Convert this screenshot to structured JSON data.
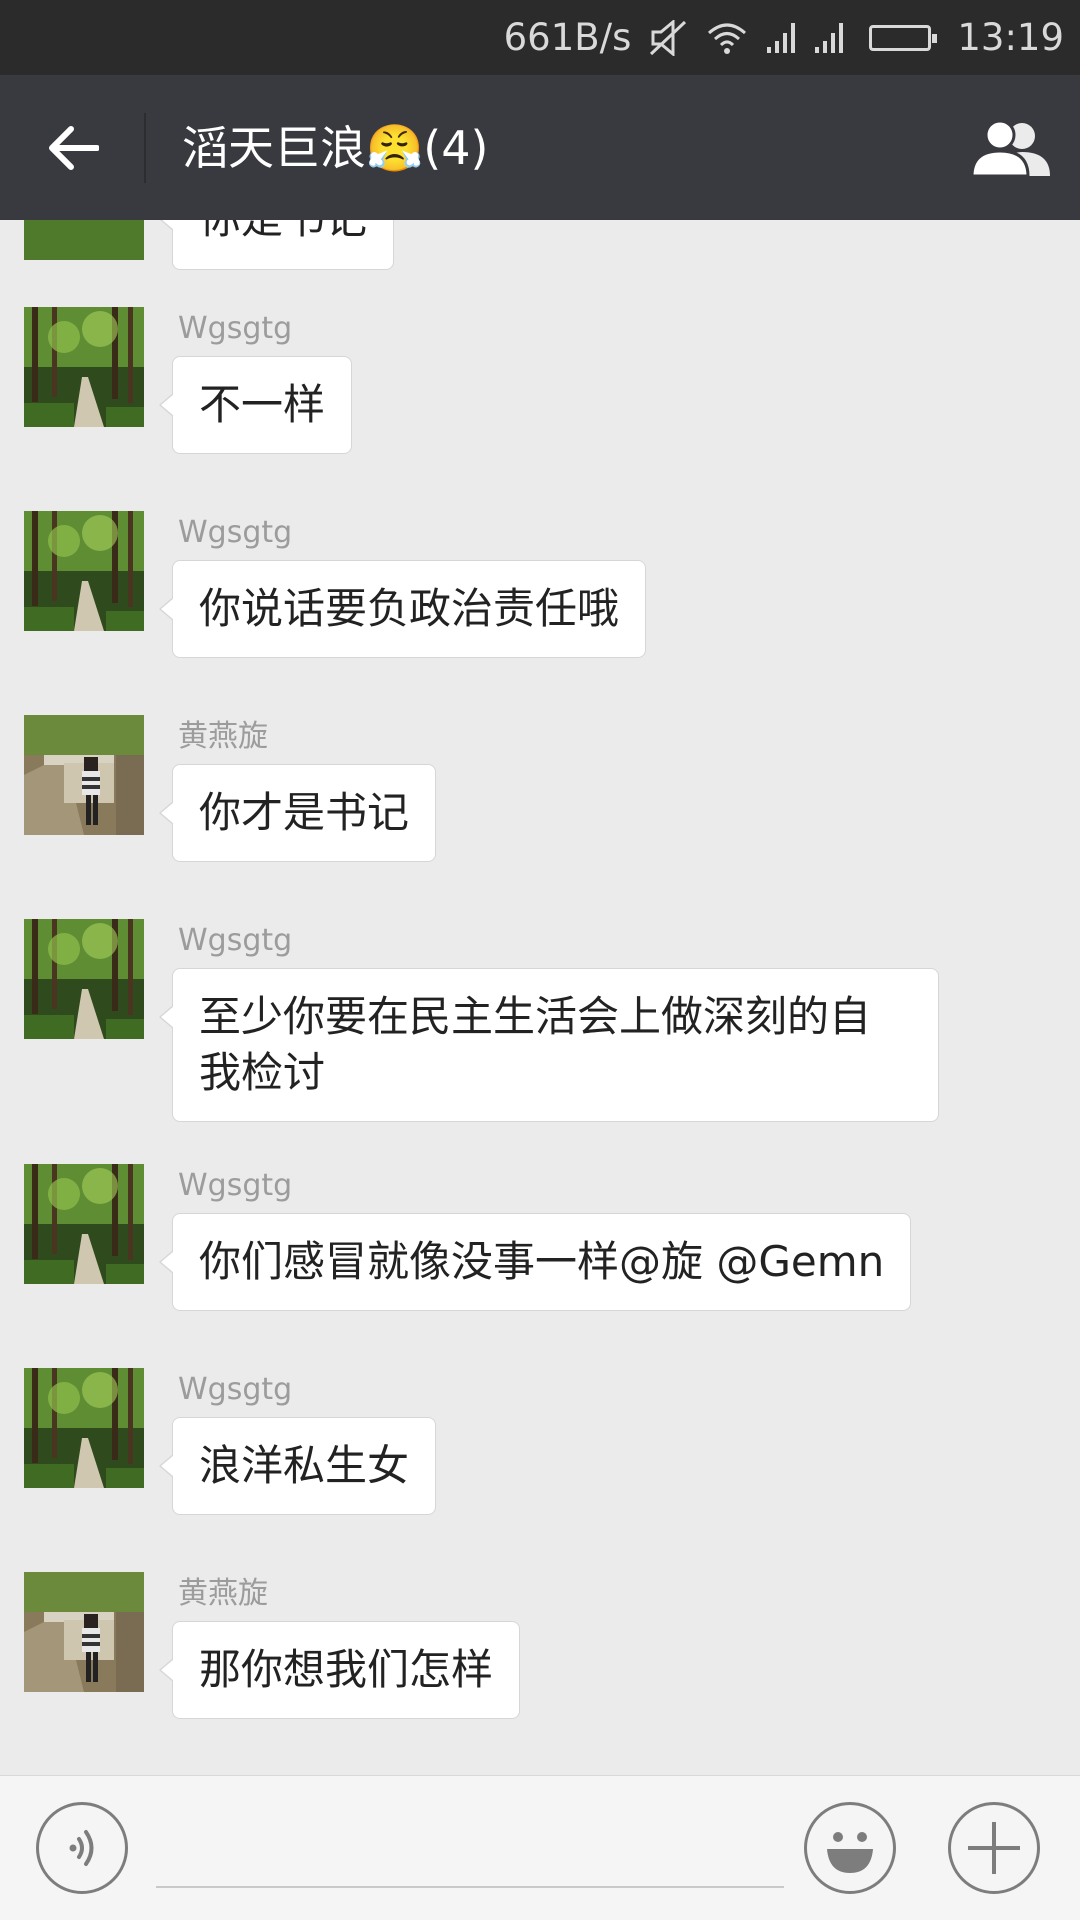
{
  "status_bar": {
    "net_speed": "661B/s",
    "time": "13:19",
    "icons": [
      "mute-icon",
      "wifi-icon",
      "signal-icon",
      "signal-icon",
      "battery-icon"
    ],
    "battery_color": "#4caf50"
  },
  "header": {
    "title": "滔天巨浪",
    "emoji": "😤",
    "member_count": "(4)",
    "back_icon": "arrow-left-icon",
    "group_icon": "people-icon"
  },
  "messages": [
    {
      "sender": "",
      "text": "你是书记",
      "avatar": "forest"
    },
    {
      "sender": "Wgsgtg",
      "text": "不一样",
      "avatar": "forest"
    },
    {
      "sender": "Wgsgtg",
      "text": "你说话要负政治责任哦",
      "avatar": "forest"
    },
    {
      "sender": "黄燕旋",
      "text": "你才是书记",
      "avatar": "person"
    },
    {
      "sender": "Wgsgtg",
      "text": "至少你要在民主生活会上做深刻的自我检讨",
      "avatar": "forest"
    },
    {
      "sender": "Wgsgtg",
      "text": "你们感冒就像没事一样@旋 @Gemn",
      "avatar": "forest"
    },
    {
      "sender": "Wgsgtg",
      "text": "浪洋私生女",
      "avatar": "forest"
    },
    {
      "sender": "黄燕旋",
      "text": "那你想我们怎样",
      "avatar": "person"
    }
  ],
  "input_bar": {
    "voice_icon": "voice-icon",
    "emoji_icon": "smiley-icon",
    "more_icon": "plus-icon",
    "input_value": ""
  },
  "colors": {
    "status_bar": "#2b2b2b",
    "title_bar": "#393a3f",
    "chat_bg": "#ebebeb",
    "bubble_bg": "#ffffff"
  }
}
